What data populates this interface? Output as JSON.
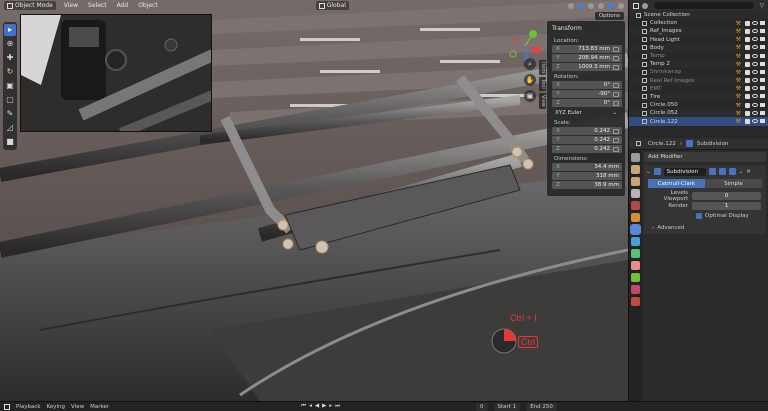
{
  "header": {
    "mode": "Object Mode",
    "menus": [
      "View",
      "Select",
      "Add",
      "Object"
    ],
    "orientation": "Global"
  },
  "viewport": {
    "options_label": "Options"
  },
  "n_panel": {
    "tabs": [
      "Item",
      "Tool",
      "View"
    ],
    "title": "Transform",
    "location_label": "Location:",
    "location": [
      {
        "axis": "X",
        "value": "713.83 mm"
      },
      {
        "axis": "Y",
        "value": "208.94 mm"
      },
      {
        "axis": "Z",
        "value": "1009.3 mm"
      }
    ],
    "rotation_label": "Rotation:",
    "rotation": [
      {
        "axis": "X",
        "value": "0°"
      },
      {
        "axis": "Y",
        "value": "-90°"
      },
      {
        "axis": "Z",
        "value": "0°"
      }
    ],
    "rotation_mode": "XYZ Euler",
    "scale_label": "Scale:",
    "scale": [
      {
        "axis": "X",
        "value": "0.242"
      },
      {
        "axis": "Y",
        "value": "0.242"
      },
      {
        "axis": "Z",
        "value": "0.242"
      }
    ],
    "dimensions_label": "Dimensions:",
    "dimensions": [
      {
        "axis": "X",
        "value": "34.4 mm"
      },
      {
        "axis": "Y",
        "value": "318 mm"
      },
      {
        "axis": "Z",
        "value": "38.9 mm"
      }
    ]
  },
  "shortcut_overlay": {
    "line1": "Ctrl + I",
    "line2": "Ctrl"
  },
  "outliner": {
    "root": "Scene Collection",
    "rows": [
      {
        "name": "Collection",
        "muted": false,
        "extra": "",
        "selected": false
      },
      {
        "name": "Ref_Images",
        "muted": false,
        "extra": "",
        "selected": false
      },
      {
        "name": "Head Light",
        "muted": false,
        "extra": "",
        "selected": false
      },
      {
        "name": "Body",
        "muted": false,
        "extra": "",
        "selected": false
      },
      {
        "name": "Temp",
        "muted": true,
        "extra": "",
        "selected": false
      },
      {
        "name": "Temp 2",
        "muted": false,
        "extra": "",
        "selected": false
      },
      {
        "name": "Shrinkwrap",
        "muted": true,
        "extra": "",
        "selected": false
      },
      {
        "name": "Real Ref Images",
        "muted": true,
        "extra": "",
        "selected": false
      },
      {
        "name": "EMT",
        "muted": true,
        "extra": "",
        "selected": false
      },
      {
        "name": "Tire",
        "muted": false,
        "extra": "",
        "selected": false
      },
      {
        "name": "Circle.050",
        "muted": false,
        "extra": "",
        "selected": false
      },
      {
        "name": "Circle.052",
        "muted": false,
        "extra": "",
        "selected": false
      },
      {
        "name": "Circle.122",
        "muted": false,
        "extra": "",
        "selected": true
      }
    ]
  },
  "properties": {
    "object_name": "Circle.122",
    "modifier_type": "Subdivision",
    "add_modifier_label": "Add Modifier",
    "modifier_name": "Subdivision",
    "subdiv_types": [
      "Catmull-Clark",
      "Simple"
    ],
    "levels_viewport_label": "Levels Viewport",
    "levels_viewport": "0",
    "render_label": "Render",
    "render": "1",
    "optimal_display_label": "Optimal Display",
    "advanced_label": "Advanced"
  },
  "timeline": {
    "menus": [
      "Playback",
      "Keying",
      "View",
      "Marker"
    ],
    "current_frame": "0",
    "start_label": "Start",
    "start": "1",
    "end_label": "End",
    "end": "250"
  },
  "colors": {
    "accent": "#4772b3",
    "shortcut_red": "#e23a3a",
    "selection": "#334d80"
  }
}
